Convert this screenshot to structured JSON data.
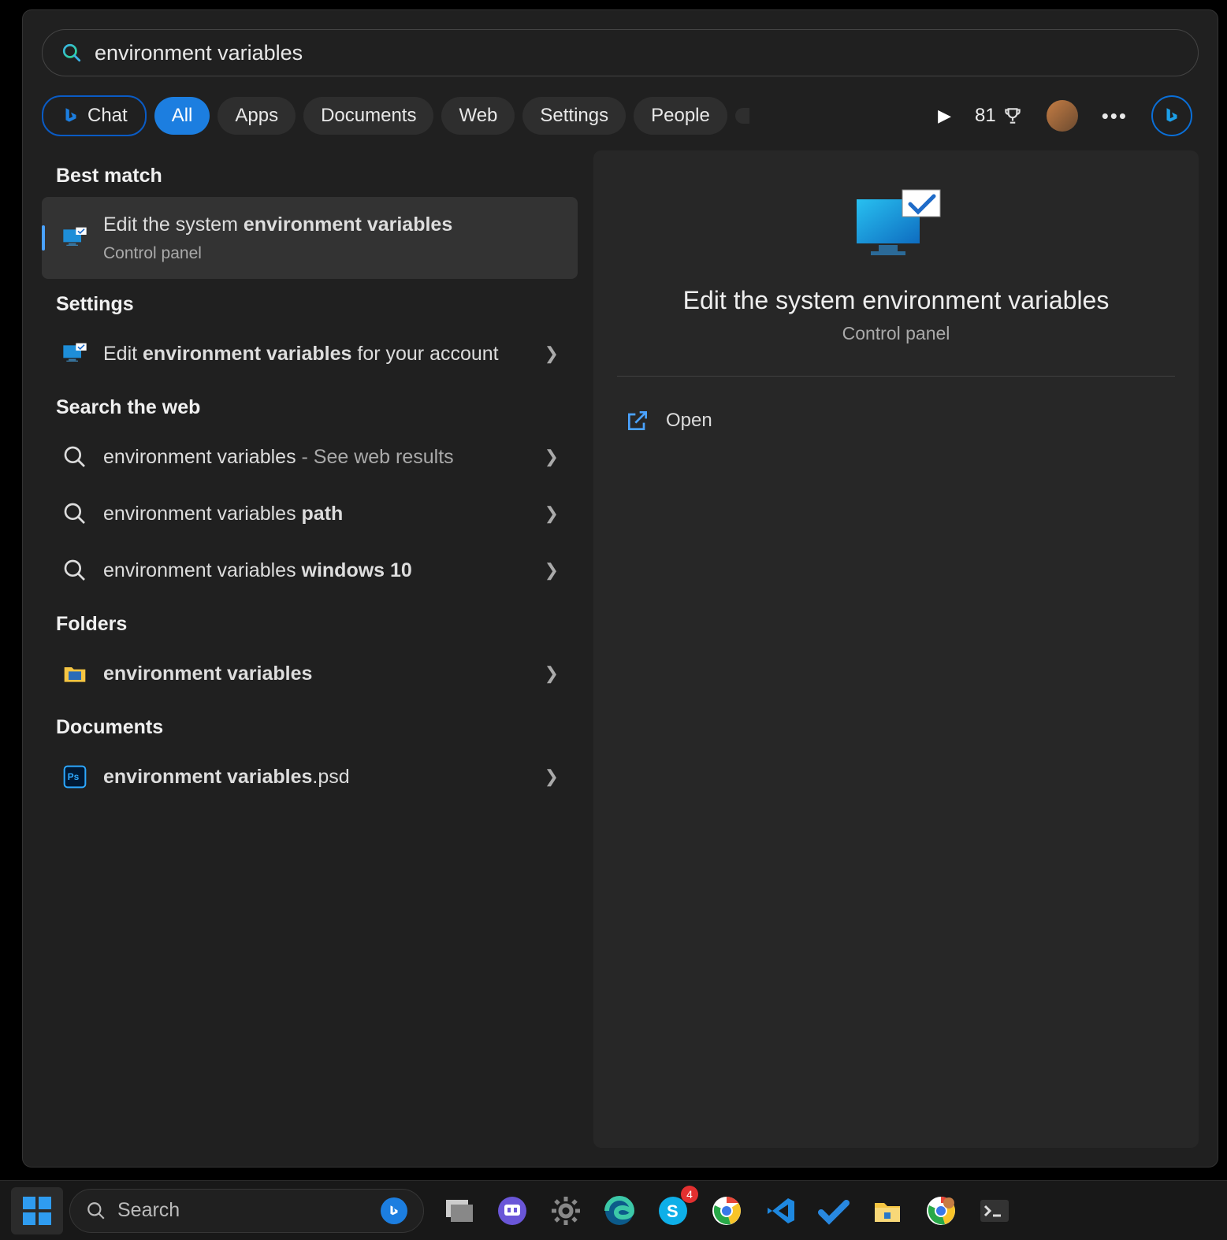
{
  "search": {
    "query": "environment variables"
  },
  "filters": {
    "chat": "Chat",
    "all": "All",
    "apps": "Apps",
    "documents": "Documents",
    "web": "Web",
    "settings": "Settings",
    "people": "People"
  },
  "status": {
    "points": "81"
  },
  "sections": {
    "best_match": "Best match",
    "settings": "Settings",
    "search_web": "Search the web",
    "folders": "Folders",
    "documents": "Documents"
  },
  "results": {
    "best_match": {
      "title_pre": "Edit the system ",
      "title_bold": "environment variables",
      "sub": "Control panel"
    },
    "settings_item": {
      "pre": "Edit ",
      "bold": "environment variables",
      "post": " for your account"
    },
    "web": {
      "item0_pre": "environment variables",
      "item0_post": " - See web results",
      "item1_pre": "environment variables ",
      "item1_bold": "path",
      "item2_pre": "environment variables ",
      "item2_bold": "windows 10"
    },
    "folders": {
      "item0_bold": "environment variables"
    },
    "documents": {
      "item0_pre": "environment variables",
      "item0_post": ".psd"
    }
  },
  "detail": {
    "title": "Edit the system environment variables",
    "sub": "Control panel",
    "open": "Open"
  },
  "taskbar": {
    "search_placeholder": "Search",
    "skype_badge": "4"
  }
}
